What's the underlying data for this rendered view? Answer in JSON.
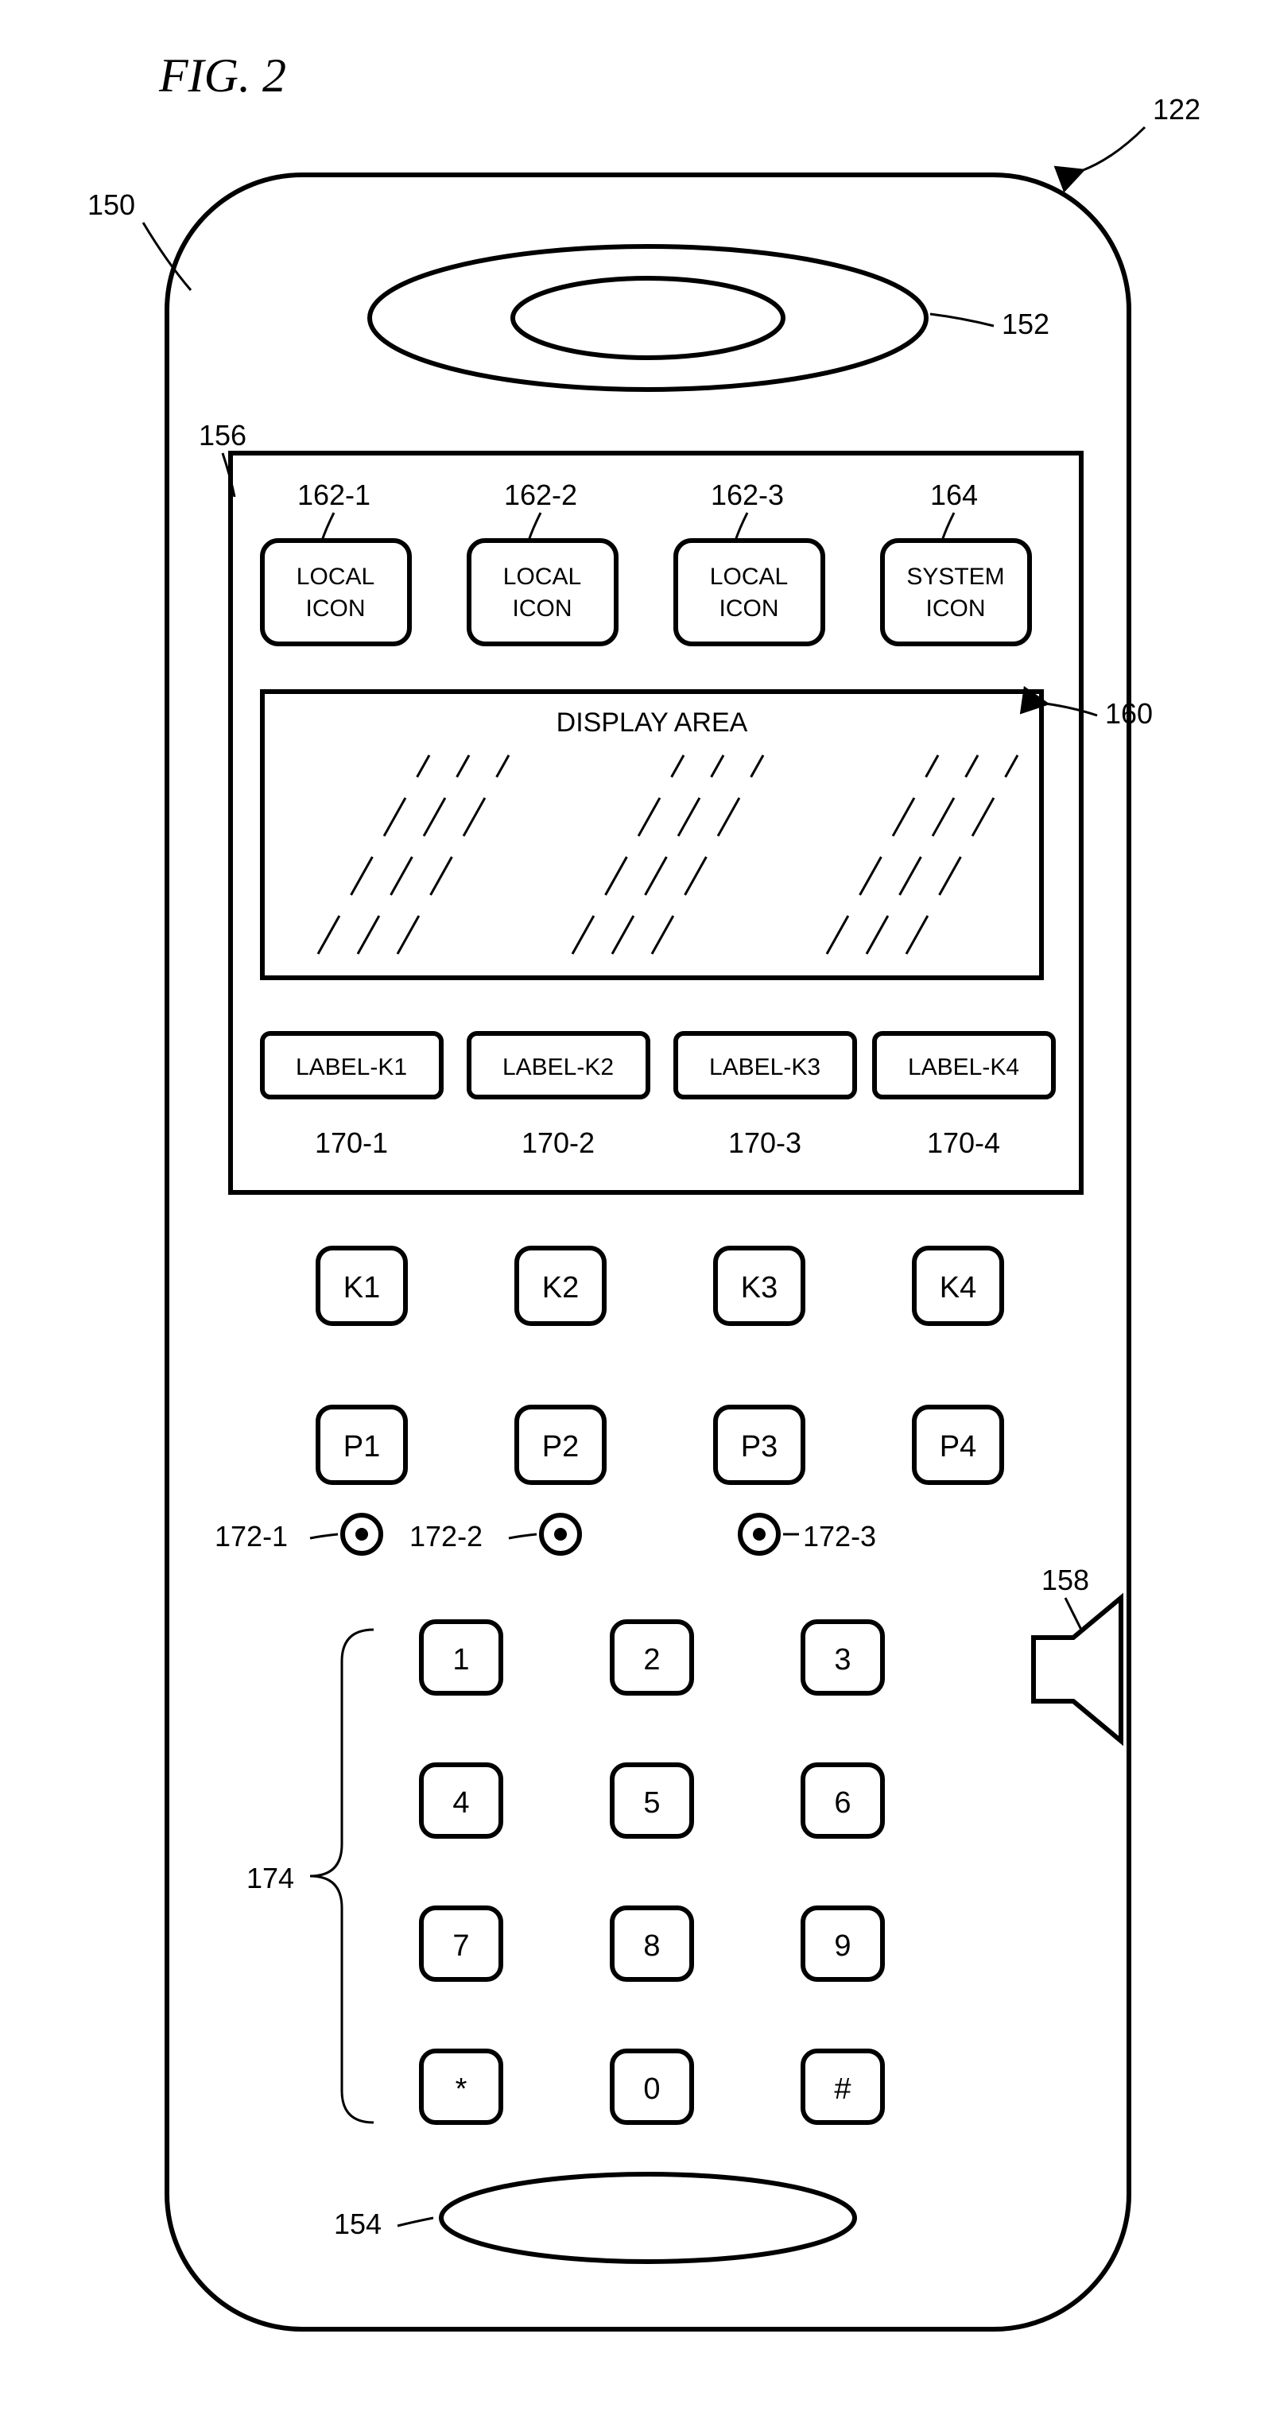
{
  "figure": {
    "title": "FIG. 2"
  },
  "callouts": {
    "device": "122",
    "housing": "150",
    "earpiece": "152",
    "mic": "154",
    "screen": "156",
    "speaker": "158",
    "display": "160",
    "icon1": "162-1",
    "icon2": "162-2",
    "icon3": "162-3",
    "icon4": "164",
    "lk1": "170-1",
    "lk2": "170-2",
    "lk3": "170-3",
    "lk4": "170-4",
    "led1": "172-1",
    "led2": "172-2",
    "led3": "172-3",
    "keypad": "174"
  },
  "icons": {
    "local": "LOCAL\nICON",
    "system": "SYSTEM\nICON"
  },
  "display": {
    "label": "DISPLAY AREA"
  },
  "labels": {
    "k1": "LABEL-K1",
    "k2": "LABEL-K2",
    "k3": "LABEL-K3",
    "k4": "LABEL-K4"
  },
  "softkeys": {
    "k1": "K1",
    "k2": "K2",
    "k3": "K3",
    "k4": "K4"
  },
  "pkeys": {
    "p1": "P1",
    "p2": "P2",
    "p3": "P3",
    "p4": "P4"
  },
  "keypad": {
    "r1": [
      "1",
      "2",
      "3"
    ],
    "r2": [
      "4",
      "5",
      "6"
    ],
    "r3": [
      "7",
      "8",
      "9"
    ],
    "r4": [
      "*",
      "0",
      "#"
    ]
  }
}
